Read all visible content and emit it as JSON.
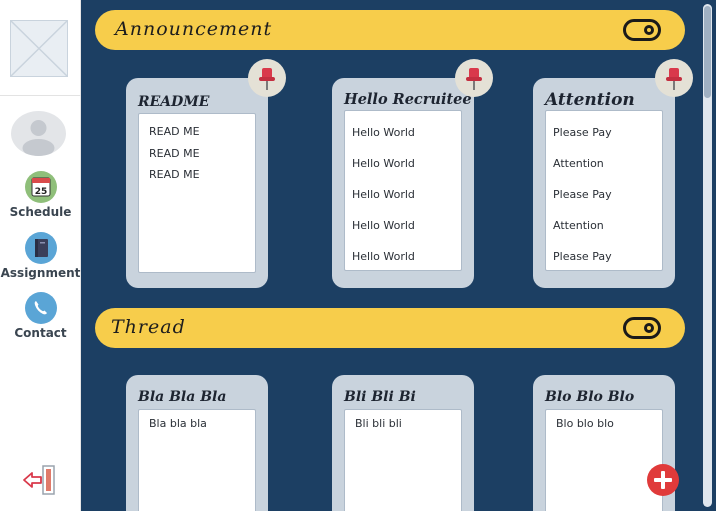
{
  "sidebar": {
    "nav": [
      {
        "label": "Schedule",
        "icon": "calendar-icon",
        "badge": "25"
      },
      {
        "label": "Assignment",
        "icon": "book-icon"
      },
      {
        "label": "Contact",
        "icon": "phone-icon"
      }
    ],
    "logout_icon": "logout-icon"
  },
  "sections": {
    "announcement": {
      "title": "Announcement",
      "cards": [
        {
          "title": "README",
          "lines": [
            "READ ME",
            "READ ME",
            "READ ME"
          ]
        },
        {
          "title": "Hello Recruitee",
          "lines": [
            "Hello World",
            "Hello World",
            "Hello World",
            "Hello World",
            "Hello World"
          ]
        },
        {
          "title": "Attention",
          "lines": [
            "Please Pay",
            "Attention",
            "Please Pay",
            "Attention",
            "Please Pay"
          ]
        }
      ]
    },
    "thread": {
      "title": "Thread",
      "cards": [
        {
          "title": "Bla Bla Bla",
          "lines": [
            "Bla bla bla"
          ]
        },
        {
          "title": "Bli Bli Bi",
          "lines": [
            "Bli bli bli"
          ]
        },
        {
          "title": "Blo Blo Blo",
          "lines": [
            "Blo blo blo"
          ]
        }
      ]
    }
  },
  "colors": {
    "main_bg": "#1c3f63",
    "section_bar": "#f7cd4b",
    "card_bg": "#c9d3dd",
    "fab": "#e03a3a",
    "pin": "#d9394b"
  },
  "fab_icon": "plus-icon"
}
